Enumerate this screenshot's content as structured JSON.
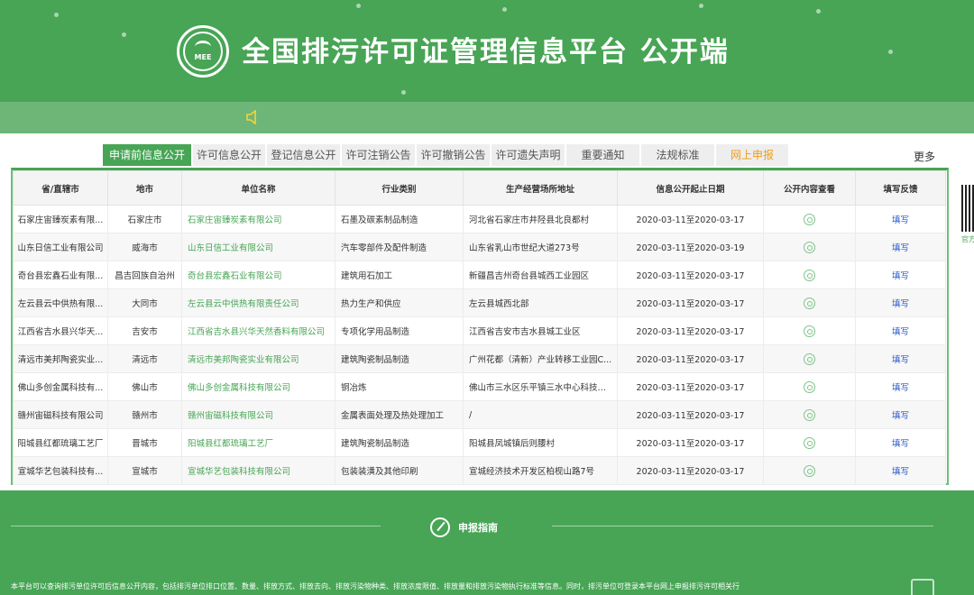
{
  "header": {
    "logo_text": "MEE",
    "title": "全国排污许可证管理信息平台  公开端"
  },
  "tabs": [
    {
      "label": "申请前信息公开",
      "active": true
    },
    {
      "label": "许可信息公开"
    },
    {
      "label": "登记信息公开"
    },
    {
      "label": "许可注销公告"
    },
    {
      "label": "许可撤销公告"
    },
    {
      "label": "许可遗失声明"
    },
    {
      "label": "重要通知"
    },
    {
      "label": "法规标准"
    },
    {
      "label": "网上申报",
      "highlight": true
    }
  ],
  "more_label": "更多",
  "table": {
    "headers": [
      "省/直辖市",
      "地市",
      "单位名称",
      "行业类别",
      "生产经营场所地址",
      "信息公开起止日期",
      "公开内容查看",
      "填写反馈"
    ],
    "rows": [
      {
        "province": "石家庄宙臻炭素有限...",
        "city": "石家庄市",
        "unit": "石家庄宙臻炭素有限公司",
        "industry": "石墨及碳素制品制造",
        "address": "河北省石家庄市井陉县北良都村",
        "dates": "2020-03-11至2020-03-17",
        "fill": "填写"
      },
      {
        "province": "山东日信工业有限公司",
        "city": "威海市",
        "unit": "山东日信工业有限公司",
        "industry": "汽车零部件及配件制造",
        "address": "山东省乳山市世纪大道273号",
        "dates": "2020-03-11至2020-03-19",
        "fill": "填写"
      },
      {
        "province": "奇台县宏鑫石业有限...",
        "city": "昌吉回族自治州",
        "unit": "奇台县宏鑫石业有限公司",
        "industry": "建筑用石加工",
        "address": "新疆昌吉州奇台县城西工业园区",
        "dates": "2020-03-11至2020-03-17",
        "fill": "填写"
      },
      {
        "province": "左云县云中供热有限...",
        "city": "大同市",
        "unit": "左云县云中供热有限责任公司",
        "industry": "热力生产和供应",
        "address": "左云县城西北部",
        "dates": "2020-03-11至2020-03-17",
        "fill": "填写"
      },
      {
        "province": "江西省吉水县兴华天...",
        "city": "吉安市",
        "unit": "江西省吉水县兴华天然香料有限公司",
        "industry": "专项化学用品制造",
        "address": "江西省吉安市吉水县城工业区",
        "dates": "2020-03-11至2020-03-17",
        "fill": "填写"
      },
      {
        "province": "清远市美邦陶瓷实业...",
        "city": "清远市",
        "unit": "清远市美邦陶瓷实业有限公司",
        "industry": "建筑陶瓷制品制造",
        "address": "广州花都（清新）产业转移工业园C...",
        "dates": "2020-03-11至2020-03-17",
        "fill": "填写"
      },
      {
        "province": "佛山多创金属科技有...",
        "city": "佛山市",
        "unit": "佛山多创金属科技有限公司",
        "industry": "铜冶炼",
        "address": "佛山市三水区乐平镇三水中心科技工...",
        "dates": "2020-03-11至2020-03-17",
        "fill": "填写"
      },
      {
        "province": "赣州宙磁科技有限公司",
        "city": "赣州市",
        "unit": "赣州宙磁科技有限公司",
        "industry": "金属表面处理及热处理加工",
        "address": "/",
        "dates": "2020-03-11至2020-03-17",
        "fill": "填写"
      },
      {
        "province": "阳城县红都琉璃工艺厂",
        "city": "晋城市",
        "unit": "阳城县红都琉璃工艺厂",
        "industry": "建筑陶瓷制品制造",
        "address": "阳城县凤城镇后则腰村",
        "dates": "2020-03-11至2020-03-17",
        "fill": "填写"
      },
      {
        "province": "宣城华艺包装科技有...",
        "city": "宣城市",
        "unit": "宣城华艺包装科技有限公司",
        "industry": "包装装潢及其他印刷",
        "address": "宣城经济技术开发区柏枧山路7号",
        "dates": "2020-03-11至2020-03-17",
        "fill": "填写"
      }
    ]
  },
  "qr_caption": "官方",
  "footer": {
    "guide_title": "申报指南",
    "text": "本平台可以查询排污单位许可后信息公开内容，包括排污单位排口位置、数量、排放方式、排放去向、排放污染物种类、排放浓度限值、排放量和排放污染物执行标准等信息。同时，排污单位可登录本平台网上申报排污许可相关行"
  },
  "colors": {
    "brand_green": "#47a555",
    "band_green": "#6db678",
    "report_orange": "#f39c12",
    "link_blue": "#2255cc"
  },
  "icons": [
    "mee-logo-icon",
    "speaker-icon",
    "magnifier-icon",
    "qr-code-icon",
    "pen-icon",
    "book-icon"
  ]
}
